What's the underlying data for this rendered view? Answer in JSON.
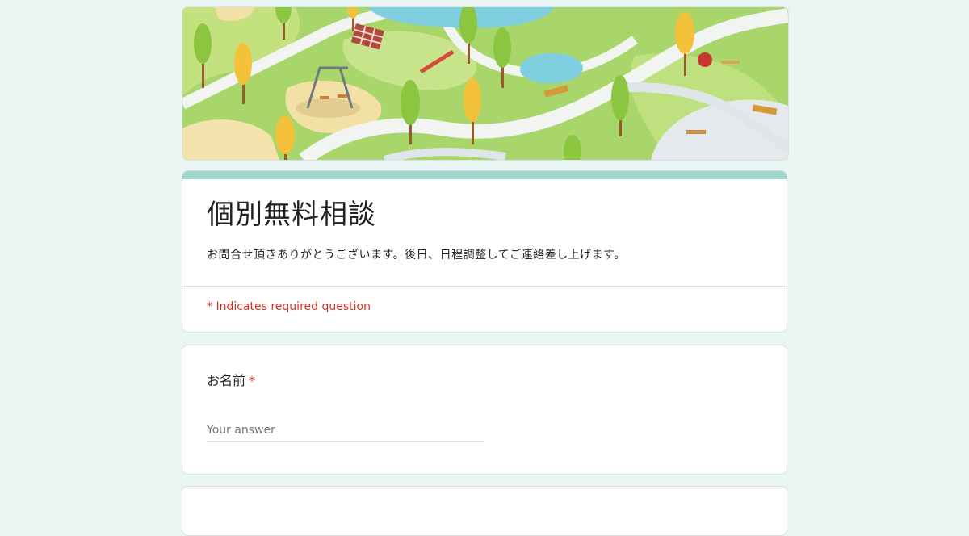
{
  "form": {
    "title": "個別無料相談",
    "description": "お問合せ頂きありがとうございます。後日、日程調整してご連絡差し上げます。",
    "required_note": "* Indicates required question",
    "accent_color": "#9fd6c9",
    "background_color": "#e9f5f3"
  },
  "questions": [
    {
      "label": "お名前",
      "required_mark": "*",
      "placeholder": "Your answer",
      "value": ""
    }
  ]
}
